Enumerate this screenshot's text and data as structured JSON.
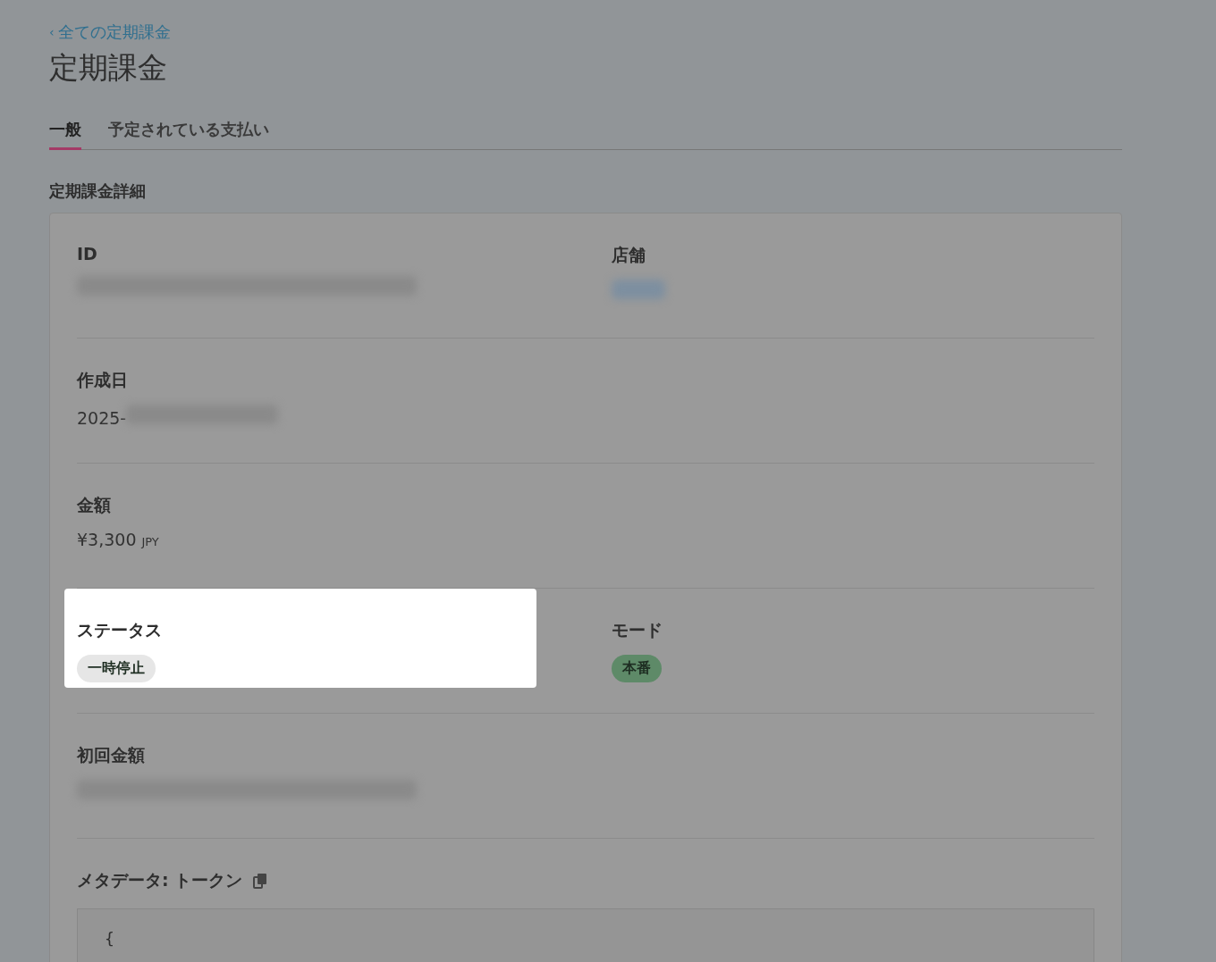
{
  "breadcrumb": {
    "icon": "‹",
    "label": "全ての定期課金"
  },
  "title": "定期課金",
  "tabs": [
    {
      "label": "一般",
      "selected": true
    },
    {
      "label": "予定されている支払い",
      "selected": false
    }
  ],
  "section_title": "定期課金詳細",
  "rows": [
    {
      "fields": [
        {
          "label": "ID",
          "kind": "redacted"
        },
        {
          "label": "店舗",
          "kind": "redacted_link"
        }
      ]
    },
    {
      "fields": [
        {
          "label": "作成日",
          "kind": "partial",
          "value": "2025-"
        }
      ]
    },
    {
      "fields": [
        {
          "label": "金額",
          "kind": "amount",
          "value": "¥3,300",
          "currency": "JPY"
        }
      ]
    },
    {
      "fields": [
        {
          "label": "ステータス",
          "kind": "badge",
          "value": "一時停止",
          "color": "#e6e6e6",
          "highlighted": true
        },
        {
          "label": "モード",
          "kind": "badge",
          "value": "本番",
          "color": "#5e8a68",
          "highlighted": false
        }
      ]
    },
    {
      "fields": [
        {
          "label": "初回金額",
          "kind": "redacted"
        }
      ]
    },
    {
      "fields": [
        {
          "label": "メタデータ: トークン",
          "kind": "code",
          "copyable": true,
          "lines": [
            "{"
          ]
        }
      ]
    }
  ]
}
